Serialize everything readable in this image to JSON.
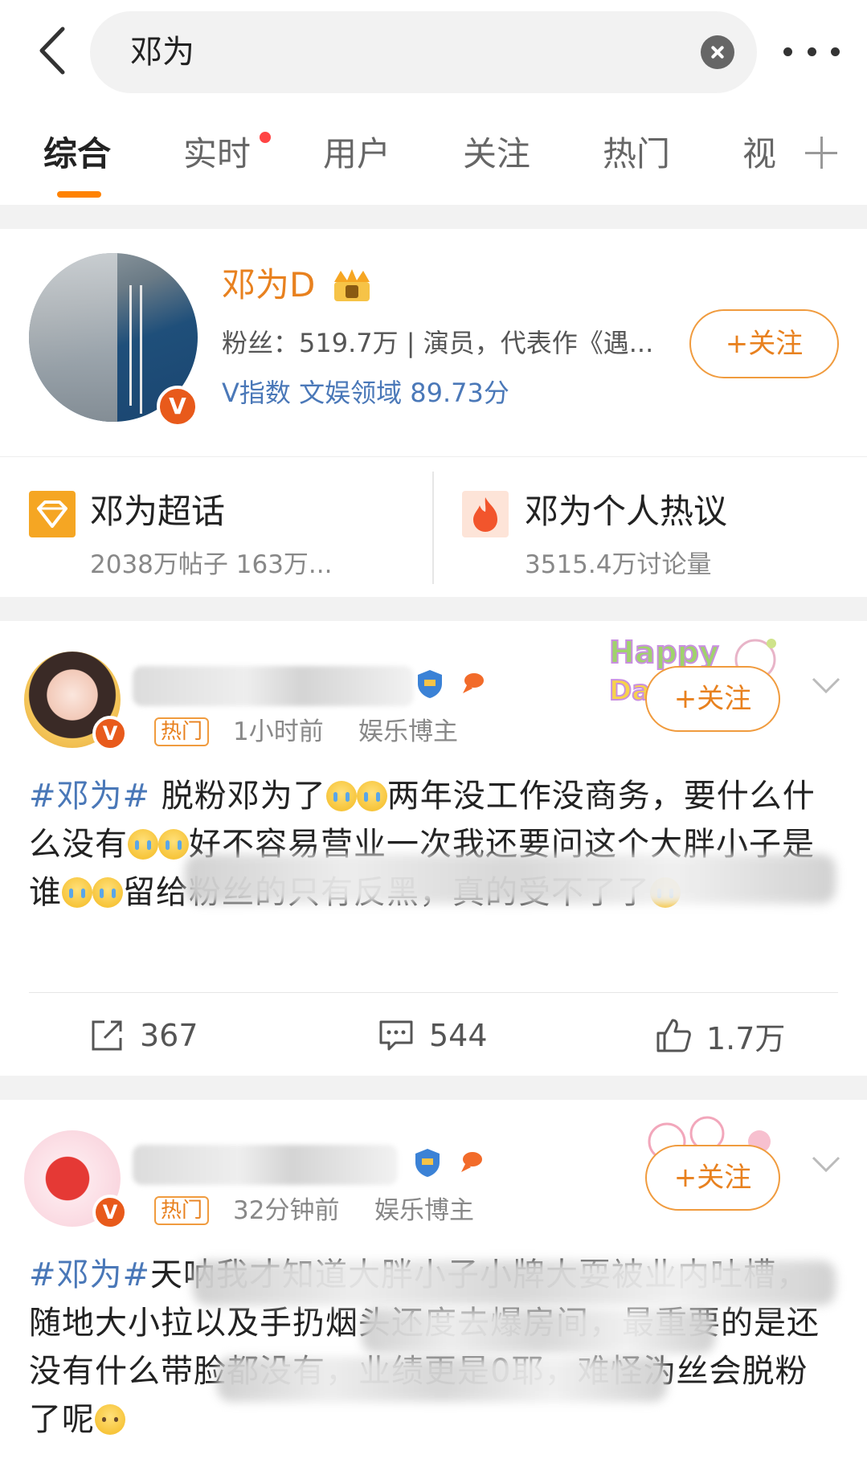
{
  "search": {
    "query": "邓为"
  },
  "tabs": [
    {
      "label": "综合",
      "active": true
    },
    {
      "label": "实时",
      "has_dot": true
    },
    {
      "label": "用户"
    },
    {
      "label": "关注"
    },
    {
      "label": "热门"
    },
    {
      "label": "视"
    }
  ],
  "user_card": {
    "name": "邓为D",
    "fans_line": "粉丝：519.7万 | 演员，代表作《遇...",
    "vindex_line": "V指数 文娱领域 89.73分",
    "follow_label": "+关注",
    "badge": "V"
  },
  "topics": [
    {
      "title": "邓为超话",
      "subtitle": "2038万帖子 163万...",
      "icon": "diamond-icon"
    },
    {
      "title": "邓为个人热议",
      "subtitle": "3515.4万讨论量",
      "icon": "fire-icon"
    }
  ],
  "posts": [
    {
      "hot_tag": "热门",
      "time": "1小时前",
      "role": "娱乐博主",
      "follow_label": "+关注",
      "badge": "V",
      "text": {
        "tag": "#邓为#",
        "p1": " 脱粉邓为了",
        "p2": "两年没工作没商务，要什么什么没有",
        "p3": "好不容易营业一次我还要问这个大胖小子是谁",
        "p4": "留给粉丝的只有反黑，真的受不了了"
      },
      "stats": {
        "repost": "367",
        "comment": "544",
        "like": "1.7万"
      }
    },
    {
      "hot_tag": "热门",
      "time": "32分钟前",
      "role": "娱乐博主",
      "follow_label": "+关注",
      "badge": "V",
      "text": {
        "tag": "#邓为#",
        "p1": "天呐我才知道大胖小子小牌大耍被业内吐槽，随地大小拉以及手扔烟头还度去爆房间，最重要的是还没有什么带脸都没有，业绩更是0耶，难怪沩丝会脱粉了呢"
      }
    }
  ],
  "colors": {
    "accent": "#ff8200",
    "link": "#4a78b8",
    "orange_text": "#e8811f"
  }
}
